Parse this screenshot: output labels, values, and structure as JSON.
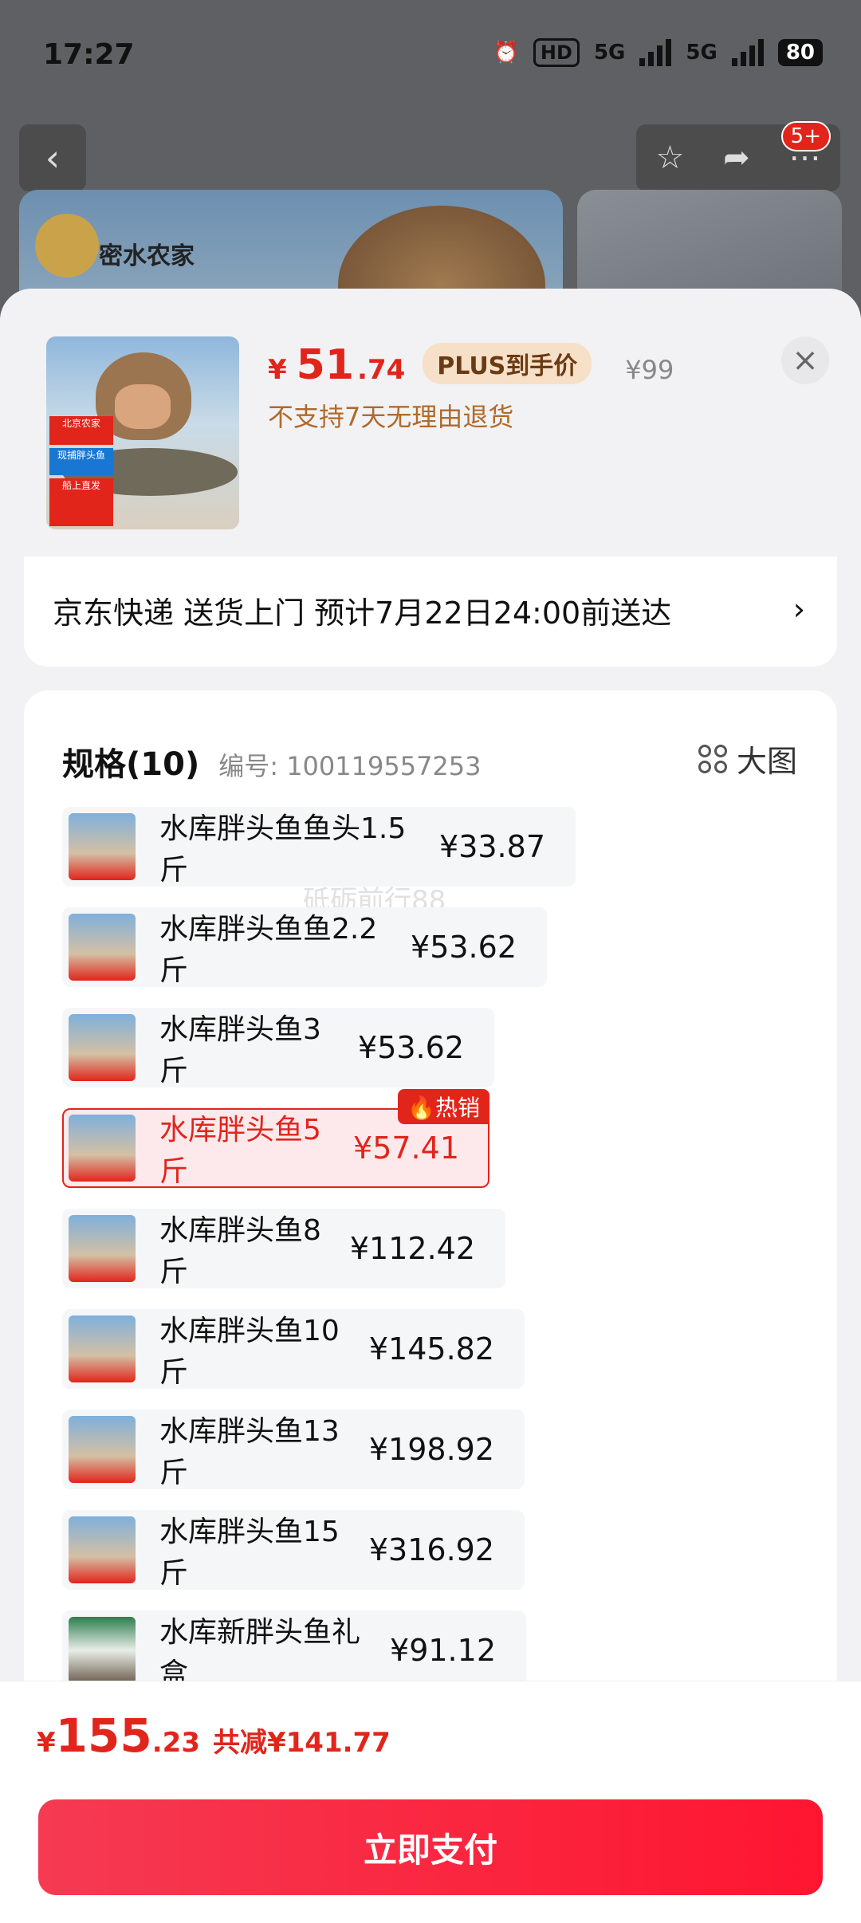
{
  "status_bar": {
    "time": "17:27",
    "hd_label": "HD",
    "net1": "5G",
    "net2": "5G",
    "battery": "80"
  },
  "header": {
    "back_icon": "chevron-left-icon",
    "favorite_icon": "star-icon",
    "share_icon": "share-icon",
    "more_icon": "more-icon",
    "badge": "5+"
  },
  "hero": {
    "brand": "密水农家"
  },
  "product": {
    "currency": "¥",
    "price_int": "51",
    "price_dec": ".74",
    "plus_tag": "PLUS到手价",
    "original_price": "¥99",
    "refund_note": "不支持7天无理由退货",
    "thumb_tags": [
      "北京农家",
      "现捕胖头鱼",
      "船上直发"
    ]
  },
  "delivery": {
    "text": "京东快递 送货上门 预计7月22日24:00前送达",
    "chevron": "›"
  },
  "spec_section": {
    "title": "规格(10)",
    "code": "编号: 100119557253",
    "big_image_label": "大图",
    "watermark": "砥砺前行88",
    "items": [
      {
        "name": "水库胖头鱼鱼头1.5斤",
        "price": "¥33.87",
        "selected": false
      },
      {
        "name": "水库胖头鱼鱼2.2斤",
        "price": "¥53.62",
        "selected": false
      },
      {
        "name": "水库胖头鱼3斤",
        "price": "¥53.62",
        "selected": false
      },
      {
        "name": "水库胖头鱼5斤",
        "price": "¥57.41",
        "selected": true,
        "badge": "热销"
      },
      {
        "name": "水库胖头鱼8斤",
        "price": "¥112.42",
        "selected": false
      },
      {
        "name": "水库胖头鱼10斤",
        "price": "¥145.82",
        "selected": false
      },
      {
        "name": "水库胖头鱼13斤",
        "price": "¥198.92",
        "selected": false
      },
      {
        "name": "水库胖头鱼15斤",
        "price": "¥316.92",
        "selected": false
      },
      {
        "name": "水库新胖头鱼礼盒",
        "price": "¥91.12",
        "selected": false
      }
    ]
  },
  "bottom": {
    "currency": "¥",
    "total_int": "155",
    "total_dec": ".23",
    "savings": "共减¥141.77",
    "pay_label": "立即支付"
  },
  "colors": {
    "accent": "#e1251b",
    "selected_bg": "#fde9ec",
    "plus_bg": "#f7e0c8"
  }
}
